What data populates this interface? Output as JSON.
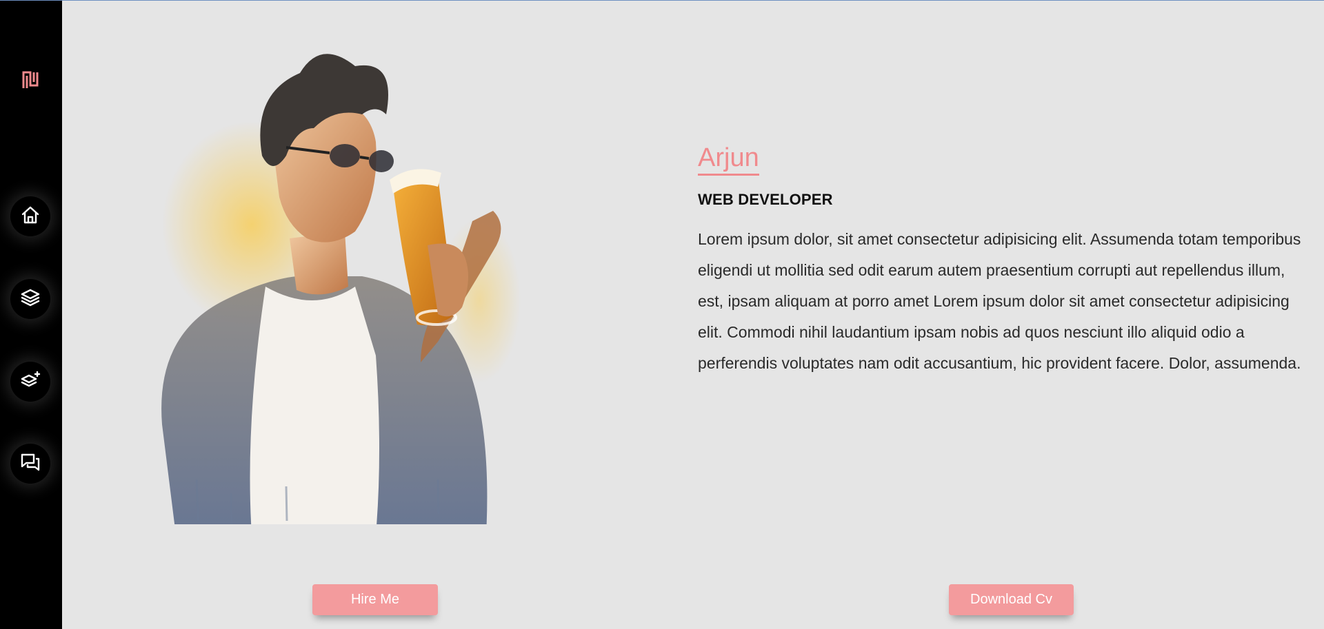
{
  "sidebar": {
    "logo_icon": "brand-logo-icon",
    "logo_color": "#f08a8d",
    "items": [
      {
        "icon": "home-icon"
      },
      {
        "icon": "layers-icon"
      },
      {
        "icon": "layers-plus-icon"
      },
      {
        "icon": "chat-icon"
      }
    ]
  },
  "profile": {
    "name": "Arjun",
    "role": "WEB DEVELOPER",
    "bio": "Lorem ipsum dolor, sit amet consectetur adipisicing elit. Assumenda totam temporibus eligendi ut mollitia sed odit earum autem praesentium corrupti aut repellendus illum, est, ipsam aliquam at porro amet Lorem ipsum dolor sit amet consectetur adipisicing elit. Commodi nihil laudantium ipsam nobis ad quos nesciunt illo aliquid odio a perferendis voluptates nam odit accusantium, hic provident facere. Dolor, assumenda."
  },
  "actions": {
    "hire_label": "Hire Me",
    "cv_label": "Download Cv"
  },
  "colors": {
    "accent": "#f08a8d",
    "button": "#f39b9d",
    "sidebar": "#000000",
    "background": "#e5e5e5"
  }
}
